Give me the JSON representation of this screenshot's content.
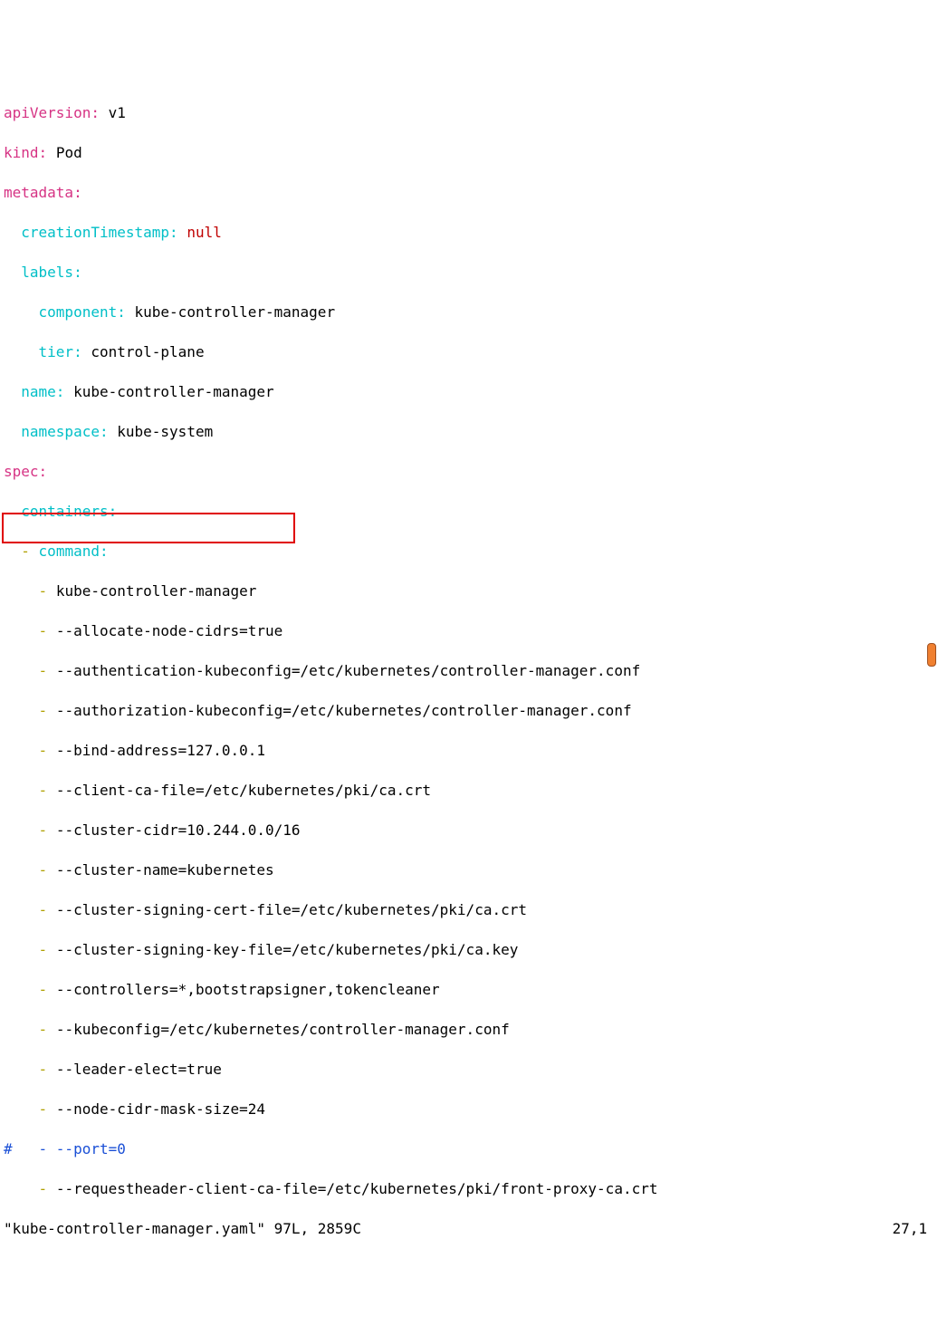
{
  "lines": {
    "l1_k": "apiVersion",
    "l1_v": "v1",
    "l2_k": "kind",
    "l2_v": "Pod",
    "l3_k": "metadata",
    "l4_k": "creationTimestamp",
    "l4_v": "null",
    "l5_k": "labels",
    "l6_k": "component",
    "l6_v": "kube-controller-manager",
    "l7_k": "tier",
    "l7_v": "control-plane",
    "l8_k": "name",
    "l8_v": "kube-controller-manager",
    "l9_k": "namespace",
    "l9_v": "kube-system",
    "l10_k": "spec",
    "l11_k": "containers",
    "l12_k": "command",
    "args": [
      "kube-controller-manager",
      "--allocate-node-cidrs=true",
      "--authentication-kubeconfig=/etc/kubernetes/controller-manager.conf",
      "--authorization-kubeconfig=/etc/kubernetes/controller-manager.conf",
      "--bind-address=127.0.0.1",
      "--client-ca-file=/etc/kubernetes/pki/ca.crt",
      "--cluster-cidr=10.244.0.0/16",
      "--cluster-name=kubernetes",
      "--cluster-signing-cert-file=/etc/kubernetes/pki/ca.crt",
      "--cluster-signing-key-file=/etc/kubernetes/pki/ca.key",
      "--controllers=*,bootstrapsigner,tokencleaner",
      "--kubeconfig=/etc/kubernetes/controller-manager.conf",
      "--leader-elect=true",
      "--node-cidr-mask-size=24"
    ],
    "commented": "#   - --port=0",
    "last": "--requestheader-client-ca-file=/etc/kubernetes/pki/front-proxy-ca.crt"
  },
  "status": {
    "left": "\"kube-controller-manager.yaml\" 97L, 2859C",
    "right": "27,1"
  }
}
